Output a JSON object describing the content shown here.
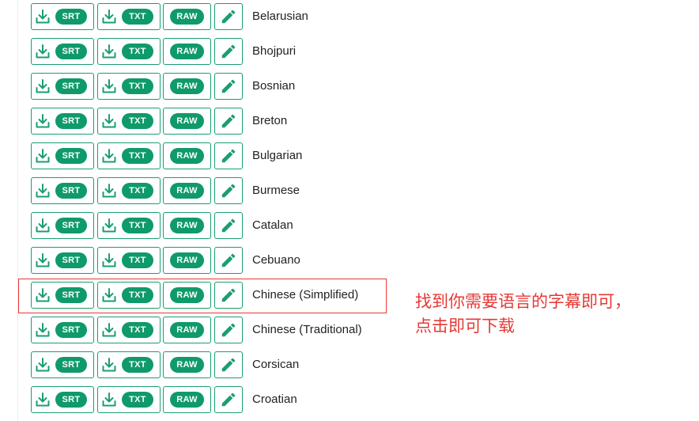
{
  "buttons": {
    "srt": "SRT",
    "txt": "TXT",
    "raw": "RAW"
  },
  "languages": [
    "Belarusian",
    "Bhojpuri",
    "Bosnian",
    "Breton",
    "Bulgarian",
    "Burmese",
    "Catalan",
    "Cebuano",
    "Chinese (Simplified)",
    "Chinese (Traditional)",
    "Corsican",
    "Croatian"
  ],
  "highlighted_language": "Chinese (Simplified)",
  "annotation": {
    "line1": "找到你需要语言的字幕即可，",
    "line2": "点击即可下载"
  },
  "colors": {
    "accent": "#0f9a6a",
    "border": "#1a9e72",
    "annotation": "#e53935"
  },
  "icons": {
    "download": "download-icon",
    "edit": "pencil-icon"
  }
}
